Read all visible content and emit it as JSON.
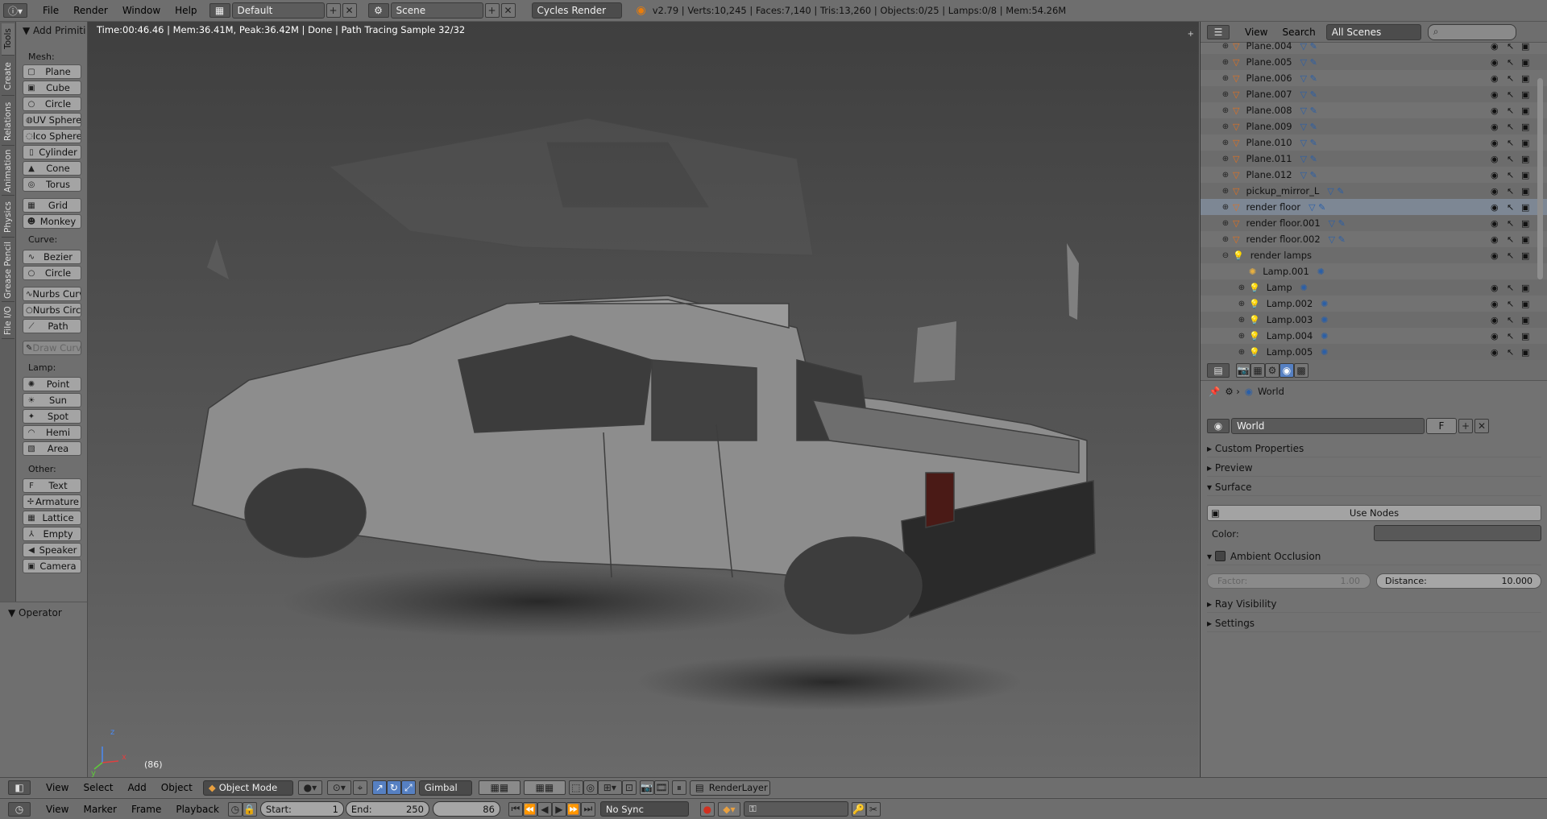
{
  "topbar": {
    "menus": [
      "File",
      "Render",
      "Window",
      "Help"
    ],
    "layout_name": "Default",
    "scene_name": "Scene",
    "engine": "Cycles Render",
    "stats": "v2.79 | Verts:10,245 | Faces:7,140 | Tris:13,260 | Objects:0/25 | Lamps:0/8 | Mem:54.26M"
  },
  "tool_tabs": [
    "Tools",
    "Create",
    "Relations",
    "Animation",
    "Physics",
    "Grease Pencil",
    "File I/O"
  ],
  "tools": {
    "header": "Add Primiti",
    "mesh_label": "Mesh:",
    "mesh": [
      "Plane",
      "Cube",
      "Circle",
      "UV Sphere",
      "Ico Sphere",
      "Cylinder",
      "Cone",
      "Torus",
      "Grid",
      "Monkey"
    ],
    "curve_label": "Curve:",
    "curve": [
      "Bezier",
      "Circle",
      "Nurbs Curv",
      "Nurbs Circl",
      "Path"
    ],
    "draw_curve": "Draw Curv",
    "lamp_label": "Lamp:",
    "lamp": [
      "Point",
      "Sun",
      "Spot",
      "Hemi",
      "Area"
    ],
    "other_label": "Other:",
    "other": [
      "Text",
      "Armature",
      "Lattice",
      "Empty",
      "Speaker",
      "Camera"
    ],
    "operator": "Operator"
  },
  "viewport": {
    "status": "Time:00:46.46 | Mem:36.41M, Peak:36.42M | Done | Path Tracing Sample 32/32",
    "frame": "(86)",
    "axis_x": "x",
    "axis_y": "y",
    "axis_z": "z"
  },
  "outliner": {
    "menus": [
      "View",
      "Search"
    ],
    "display": "All Scenes",
    "items": [
      "Plane.004",
      "Plane.005",
      "Plane.006",
      "Plane.007",
      "Plane.008",
      "Plane.009",
      "Plane.010",
      "Plane.011",
      "Plane.012",
      "pickup_mirror_L",
      "render floor",
      "render floor.001",
      "render floor.002",
      "render lamps",
      "Lamp.001",
      "Lamp",
      "Lamp.002",
      "Lamp.003",
      "Lamp.004",
      "Lamp.005"
    ]
  },
  "properties": {
    "breadcrumb": "World",
    "world_name": "World",
    "fake_user": "F",
    "panels": {
      "custom": "Custom Properties",
      "preview": "Preview",
      "surface": "Surface",
      "use_nodes": "Use Nodes",
      "color_label": "Color:",
      "ao": "Ambient Occlusion",
      "factor_label": "Factor:",
      "factor_value": "1.00",
      "distance_label": "Distance:",
      "distance_value": "10.000",
      "ray": "Ray Visibility",
      "settings": "Settings"
    }
  },
  "view3d_header": {
    "menus": [
      "View",
      "Select",
      "Add",
      "Object"
    ],
    "mode": "Object Mode",
    "orientation": "Gimbal",
    "render_layer": "RenderLayer"
  },
  "timeline": {
    "menus": [
      "View",
      "Marker",
      "Frame",
      "Playback"
    ],
    "start_label": "Start:",
    "start": "1",
    "end_label": "End:",
    "end": "250",
    "current": "86",
    "sync": "No Sync"
  }
}
